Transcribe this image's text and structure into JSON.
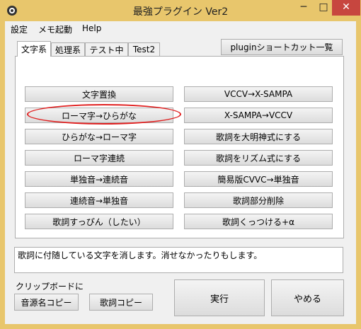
{
  "window": {
    "title": "最強プラグイン Ver2",
    "minimize_glyph": "─",
    "maximize_glyph": "□",
    "close_glyph": "✕"
  },
  "menu": {
    "items": [
      "設定",
      "メモ起動",
      "Help"
    ]
  },
  "plugin_shortcut_label": "pluginショートカット一覧",
  "tabs": [
    {
      "label": "文字系",
      "active": true
    },
    {
      "label": "処理系",
      "active": false
    },
    {
      "label": "テスト中",
      "active": false
    },
    {
      "label": "Test2",
      "active": false
    }
  ],
  "left_buttons": [
    "文字置換",
    "ローマ字→ひらがな",
    "ひらがな→ローマ字",
    "ローマ字連続",
    "単独音→連続音",
    "連続音→単独音",
    "歌詞すっぴん（したい）"
  ],
  "right_buttons": [
    "VCCV→X-SAMPA",
    "X-SAMPA→VCCV",
    "歌詞を大明神式にする",
    "歌詞をリズム式にする",
    "簡易版CVVC→単独音",
    "歌詞部分削除",
    "歌詞くっつける+α"
  ],
  "description": "歌詞に付随している文字を消します。消せなかったりもします。",
  "clipboard": {
    "label": "クリップボードに",
    "copy_source_label": "音源名コピー",
    "copy_lyrics_label": "歌詞コピー"
  },
  "run_label": "実行",
  "cancel_label": "やめる",
  "colors": {
    "titlebar": "#e8c66c",
    "close_button": "#c7463f",
    "highlight_ring": "#e02020"
  }
}
